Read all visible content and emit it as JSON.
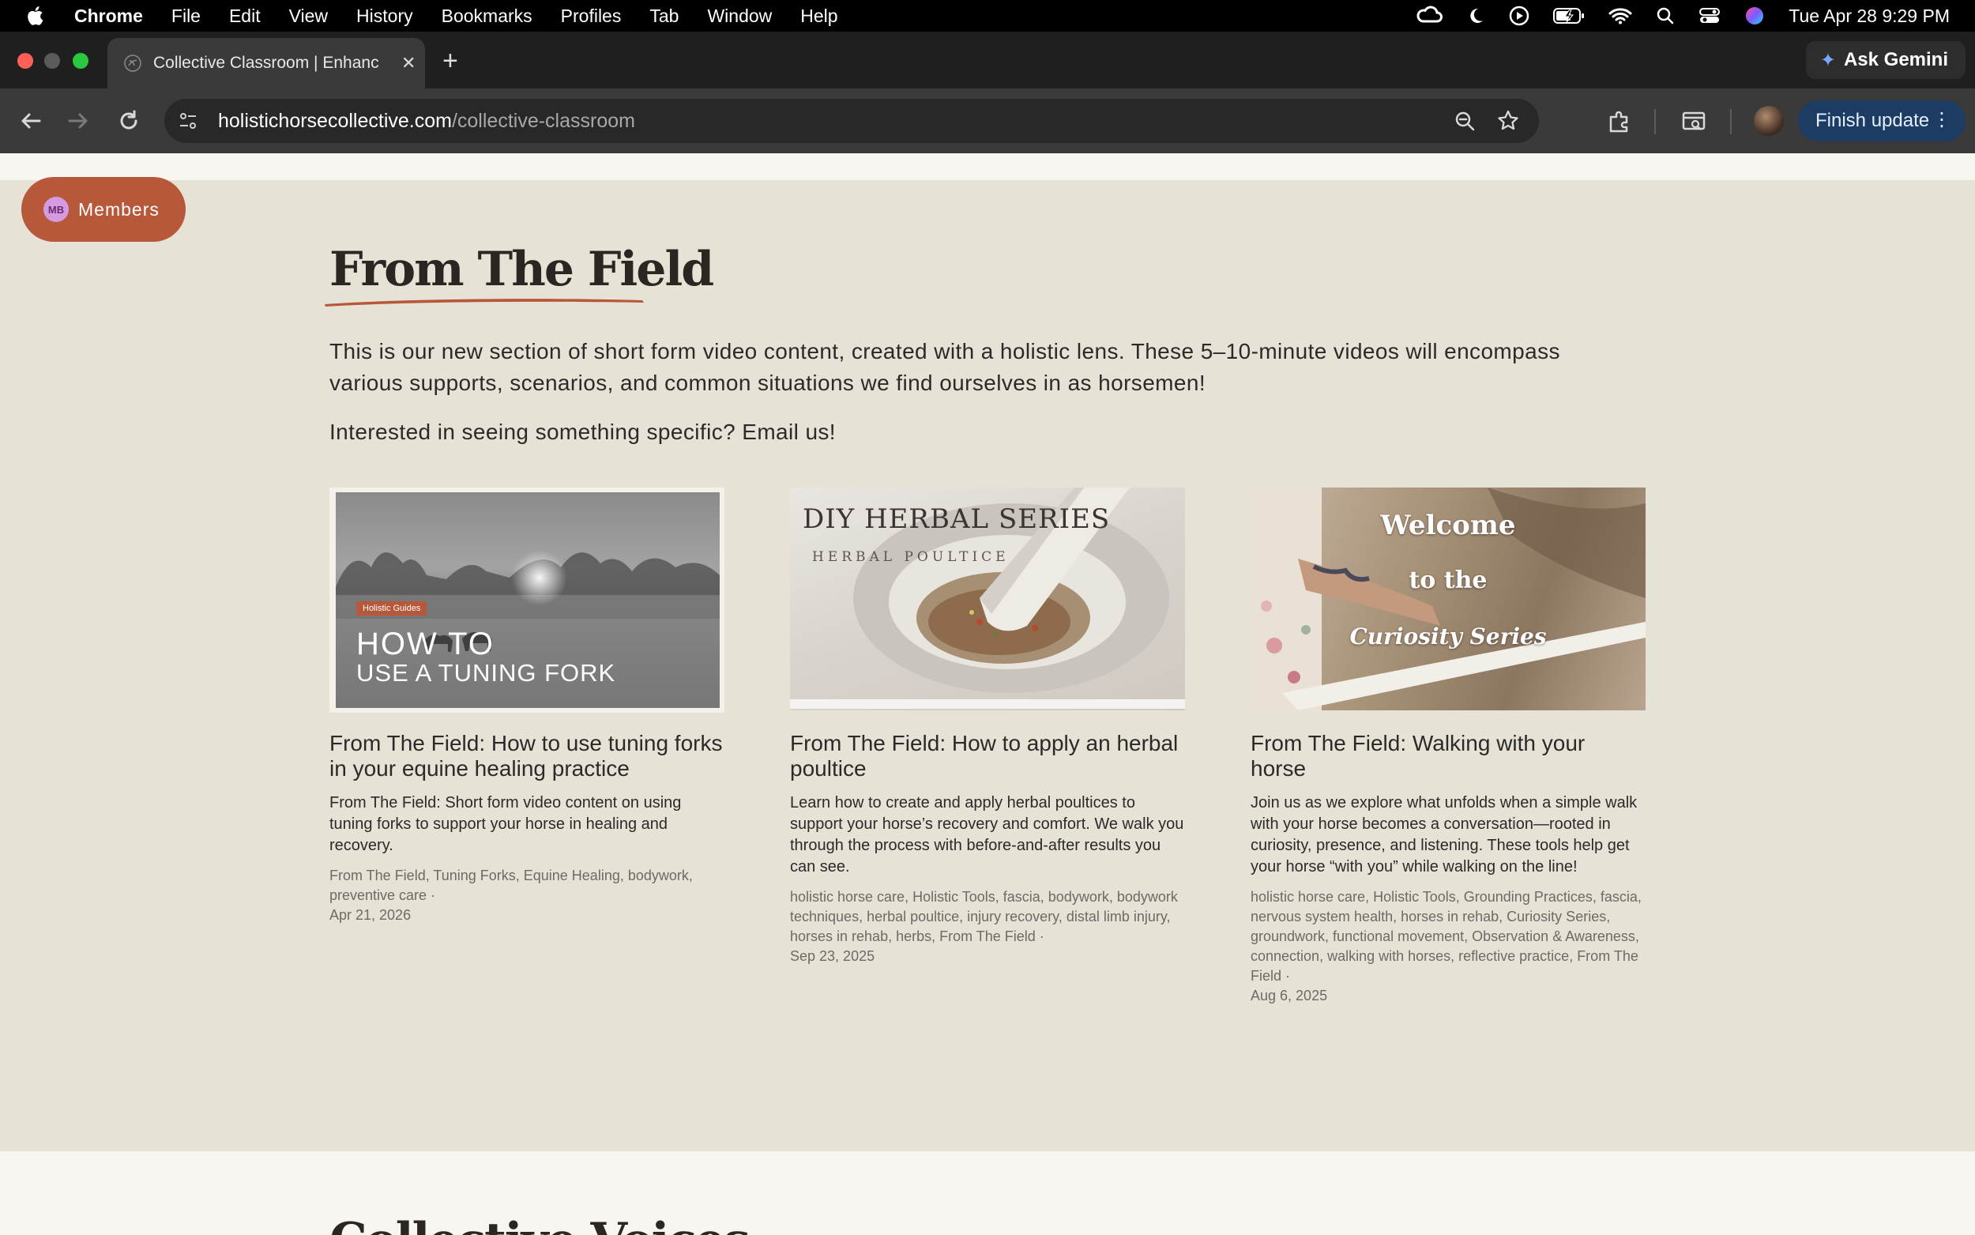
{
  "os_menubar": {
    "app_name": "Chrome",
    "menus": [
      "File",
      "Edit",
      "View",
      "History",
      "Bookmarks",
      "Profiles",
      "Tab",
      "Window",
      "Help"
    ],
    "clock": "Tue Apr 28  9:29 PM"
  },
  "browser": {
    "tab_title": "Collective Classroom | Enhanc",
    "ask_gemini": "Ask Gemini",
    "url_host": "holistichorsecollective.com",
    "url_path": "/collective-classroom",
    "finish_update": "Finish update"
  },
  "members_button": {
    "initials": "MB",
    "label": "Members"
  },
  "section": {
    "heading": "From The Field",
    "intro_line1": "This is our new section of short form video content, created with a holistic lens. These 5–10-minute videos will encompass",
    "intro_line2": "various supports, scenarios, and common situations we find ourselves in as horsemen!",
    "intro_email": "Interested in seeing something specific? Email us!"
  },
  "cards": [
    {
      "thumb_badge": "Holistic Guides",
      "thumb_line1": "HOW TO",
      "thumb_line2": "USE A TUNING FORK",
      "title": "From The Field: How to use tuning forks in your equine healing practice",
      "description": "From The Field: Short form video content on using tuning forks to support your horse in healing and recovery.",
      "tags": "From The Field, Tuning Forks, Equine Healing, bodywork, preventive care  ·",
      "date": "Apr 21, 2026"
    },
    {
      "thumb_line1": "DIY HERBAL SERIES",
      "thumb_line2": "HERBAL POULTICE",
      "title": "From The Field: How to apply an herbal poultice",
      "description": "Learn how to create and apply herbal poultices to support your horse’s recovery and comfort. We walk you through the process with before-and-after results you can see.",
      "tags": "holistic horse care, Holistic Tools, fascia, bodywork, bodywork techniques, herbal poultice, injury recovery, distal limb injury, horses in rehab, herbs, From The Field  ·",
      "date": "Sep 23, 2025"
    },
    {
      "thumb_line1": "Welcome",
      "thumb_line2": "to the",
      "thumb_line3": "Curiosity Series",
      "title": "From The Field: Walking with your horse",
      "description": "Join us as we explore what unfolds when a simple walk with your horse becomes a conversation—rooted in curiosity, presence, and listening. These tools help get your horse “with you” while walking on the line!",
      "tags": "holistic horse care, Holistic Tools, Grounding Practices, fascia, nervous system health, horses in rehab, Curiosity Series, groundwork, functional movement, Observation & Awareness, connection, walking with horses, reflective practice, From The Field  ·",
      "date": "Aug 6, 2025"
    }
  ],
  "next_section_heading": "Collective Voices"
}
